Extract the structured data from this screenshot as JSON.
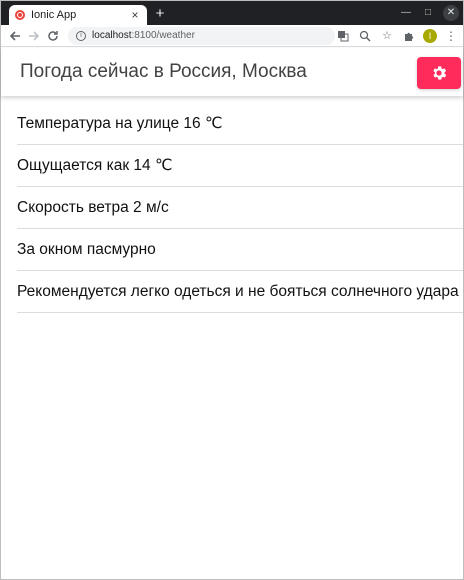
{
  "browser": {
    "tab_title": "Ionic App",
    "tab_close": "×",
    "new_tab": "+",
    "url_host": "localhost",
    "url_path": ":8100/weather",
    "avatar_letter": "I"
  },
  "header": {
    "title": "Погода сейчас в Россия, Москва",
    "settings_icon": "gear-icon",
    "accent_color": "#ff2b5b"
  },
  "weather": {
    "items": [
      "Температура на улице 16 ℃",
      "Ощущается как 14 ℃",
      "Скорость ветра 2 м/с",
      "За окном пасмурно",
      "Рекомендуется легко одеться и не бояться солнечного удара"
    ]
  }
}
